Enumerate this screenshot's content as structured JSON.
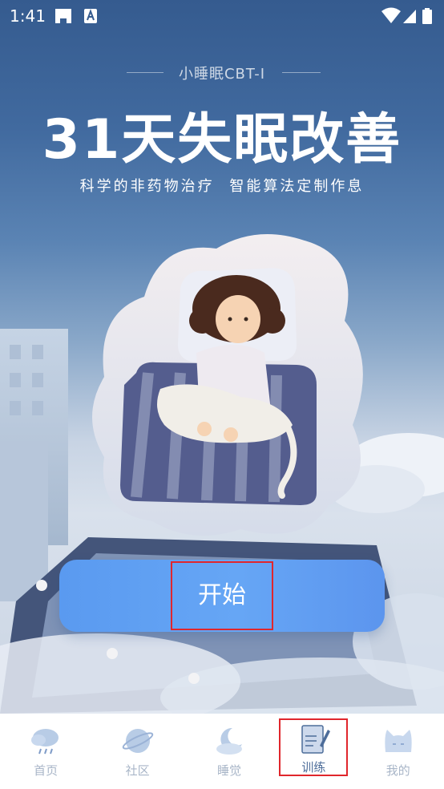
{
  "status_bar": {
    "time": "1:41",
    "icons": [
      "game-controller-icon",
      "a-badge-icon",
      "wifi-icon",
      "signal-icon",
      "battery-icon"
    ]
  },
  "header": {
    "subtitle": "小睡眠CBT-I",
    "title": "31天失眠改善",
    "tagline": "科学的非药物治疗  智能算法定制作息"
  },
  "main": {
    "start_button_label": "开始"
  },
  "bottom_nav": {
    "items": [
      {
        "label": "首页",
        "icon": "cloud-rain-icon",
        "active": false
      },
      {
        "label": "社区",
        "icon": "planet-icon",
        "active": false
      },
      {
        "label": "睡觉",
        "icon": "moon-cloud-icon",
        "active": false
      },
      {
        "label": "训练",
        "icon": "notebook-pen-icon",
        "active": true
      },
      {
        "label": "我的",
        "icon": "cat-face-icon",
        "active": false
      }
    ]
  },
  "colors": {
    "sky_top": "#355b8f",
    "button": "#66a6f5",
    "nav_inactive": "#a9b6c8",
    "nav_active": "#4d6d9a",
    "highlight_box": "#e0262c"
  }
}
